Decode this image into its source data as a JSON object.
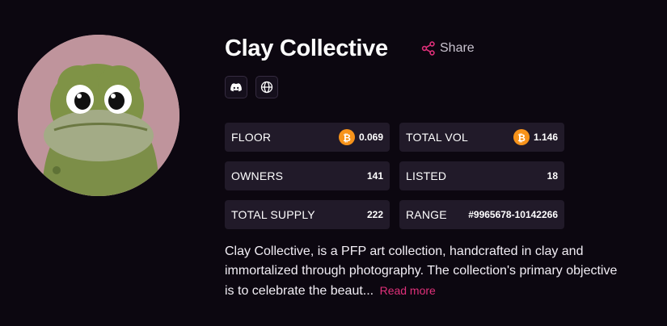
{
  "collection": {
    "name": "Clay Collective",
    "avatar_icon": "clay-frog-avatar"
  },
  "share": {
    "label": "Share",
    "icon": "share-icon",
    "color": "#e0307a"
  },
  "social_links": [
    {
      "name": "discord",
      "icon": "discord-icon"
    },
    {
      "name": "website",
      "icon": "globe-icon"
    }
  ],
  "stats": {
    "floor": {
      "label": "FLOOR",
      "value": "0.069",
      "icon": "bitcoin-icon"
    },
    "total_vol": {
      "label": "TOTAL VOL",
      "value": "1.146",
      "icon": "bitcoin-icon"
    },
    "owners": {
      "label": "OWNERS",
      "value": "141"
    },
    "listed": {
      "label": "LISTED",
      "value": "18"
    },
    "total_supply": {
      "label": "TOTAL SUPPLY",
      "value": "222"
    },
    "range": {
      "label": "RANGE",
      "value": "#9965678-10142266"
    }
  },
  "description": {
    "text": "Clay Collective, is a PFP art collection, handcrafted in clay and immortalized through photography. The collection's primary objective is to celebrate the beaut...",
    "read_more": "Read more"
  },
  "colors": {
    "background": "#0c0710",
    "card": "#211a29",
    "accent": "#e0307a",
    "bitcoin": "#f7931a"
  }
}
